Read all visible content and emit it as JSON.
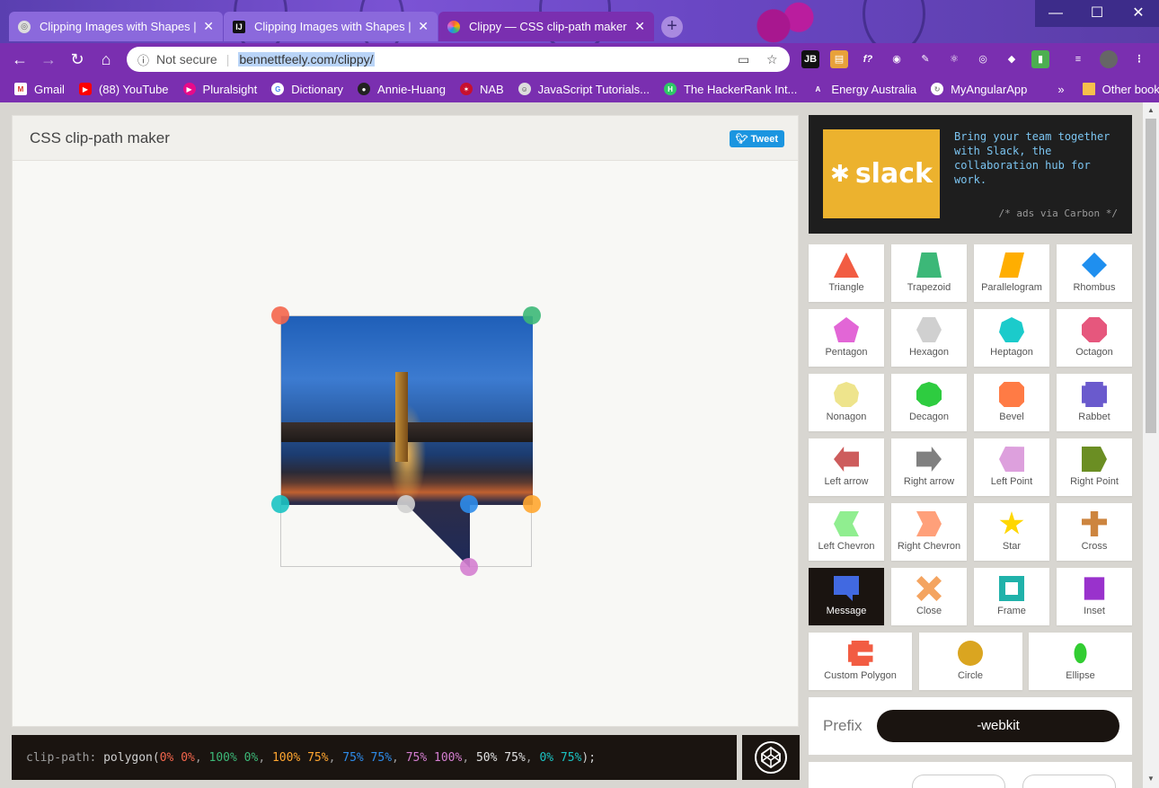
{
  "browser": {
    "tabs": [
      {
        "title": "Clipping Images with Shapes | Co",
        "active": false
      },
      {
        "title": "Clipping Images with Shapes | Co",
        "active": false
      },
      {
        "title": "Clippy — CSS clip-path maker",
        "active": true
      }
    ],
    "security_label": "Not secure",
    "url": "bennettfeely.com/clippy/",
    "bookmarks": [
      "Gmail",
      "(88) YouTube",
      "Pluralsight",
      "Dictionary",
      "Annie-Huang",
      "NAB",
      "JavaScript Tutorials...",
      "The HackerRank Int...",
      "Energy Australia",
      "MyAngularApp"
    ],
    "more_bookmarks": "»",
    "other_bookmarks": "Other bookmarks"
  },
  "app": {
    "title": "CSS clip-path maker",
    "tweet_label": "Tweet"
  },
  "ad": {
    "brand": "slack",
    "text": "Bring your team together with Slack, the collaboration hub for work.",
    "via": "/* ads via Carbon */"
  },
  "shapes": [
    {
      "label": "Triangle",
      "color": "#f25c42"
    },
    {
      "label": "Trapezoid",
      "color": "#3cb878"
    },
    {
      "label": "Parallelogram",
      "color": "#ffae00"
    },
    {
      "label": "Rhombus",
      "color": "#1f8fef"
    },
    {
      "label": "Pentagon",
      "color": "#e266d6"
    },
    {
      "label": "Hexagon",
      "color": "#d0d0d0"
    },
    {
      "label": "Heptagon",
      "color": "#1bcbcb"
    },
    {
      "label": "Octagon",
      "color": "#e6577d"
    },
    {
      "label": "Nonagon",
      "color": "#eee48c"
    },
    {
      "label": "Decagon",
      "color": "#2ecc40"
    },
    {
      "label": "Bevel",
      "color": "#ff7b45"
    },
    {
      "label": "Rabbet",
      "color": "#6a5acd"
    },
    {
      "label": "Left arrow",
      "color": "#cd5c5c"
    },
    {
      "label": "Right arrow",
      "color": "#808080"
    },
    {
      "label": "Left Point",
      "color": "#dda0dd"
    },
    {
      "label": "Right Point",
      "color": "#6b8e23"
    },
    {
      "label": "Left Chevron",
      "color": "#90ee90"
    },
    {
      "label": "Right Chevron",
      "color": "#ffa07a"
    },
    {
      "label": "Star",
      "color": "#ffd700"
    },
    {
      "label": "Cross",
      "color": "#cd853f"
    },
    {
      "label": "Message",
      "color": "#4169e1",
      "selected": true
    },
    {
      "label": "Close",
      "color": "#f4a460"
    },
    {
      "label": "Frame",
      "color": "#20b2aa"
    },
    {
      "label": "Inset",
      "color": "#9932cc"
    },
    {
      "label": "Custom Polygon",
      "color": "#f25c42"
    },
    {
      "label": "Circle",
      "color": "#daa520"
    },
    {
      "label": "Ellipse",
      "color": "#32cd32"
    }
  ],
  "prefix": {
    "label": "Prefix",
    "value": "-webkit"
  },
  "code": {
    "property": "clip-path: ",
    "function": "polygon(",
    "points": [
      {
        "text": "0% 0%",
        "color": "#f4664d"
      },
      {
        "text": "100% 0%",
        "color": "#3cb878"
      },
      {
        "text": "100% 75%",
        "color": "#ffa630"
      },
      {
        "text": "75% 75%",
        "color": "#2e8cea"
      },
      {
        "text": "75% 100%",
        "color": "#d47ed0"
      },
      {
        "text": "50% 75%",
        "color": "#e0e0e0"
      },
      {
        "text": "0% 75%",
        "color": "#1bc3c3"
      }
    ],
    "end": ");"
  }
}
